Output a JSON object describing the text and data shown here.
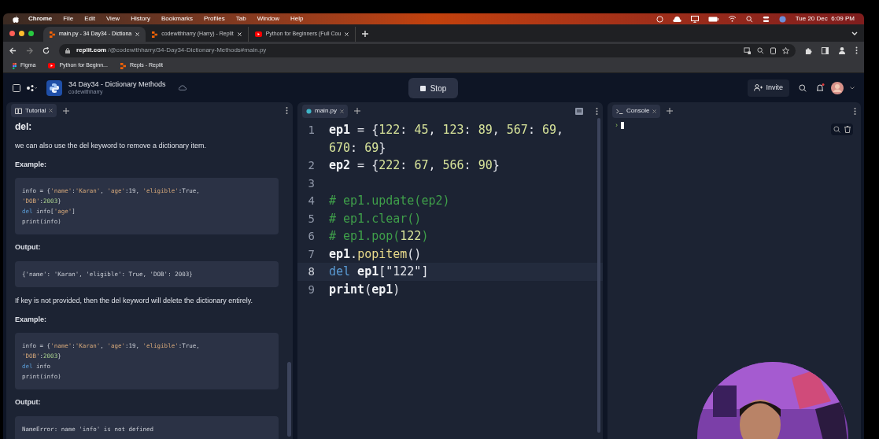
{
  "menu_bar": {
    "items": [
      "Chrome",
      "File",
      "Edit",
      "View",
      "History",
      "Bookmarks",
      "Profiles",
      "Tab",
      "Window",
      "Help"
    ],
    "clock": "Tue 20 Dec  6:09 PM"
  },
  "browser": {
    "tabs": [
      {
        "label": "main.py - 34 Day34 - Dictiona",
        "kind": "replit",
        "selected": true
      },
      {
        "label": "codewithharry (Harry) - Replit",
        "kind": "replit",
        "selected": false
      },
      {
        "label": "Python for Beginners (Full Cou",
        "kind": "youtube",
        "selected": false
      }
    ],
    "address": {
      "host": "replit.com",
      "path": "/@codewithharry/34-Day34-Dictionary-Methods#main.py"
    },
    "bookmarks": [
      {
        "label": "Figma",
        "kind": "figma"
      },
      {
        "label": "Python for Beginn...",
        "kind": "youtube"
      },
      {
        "label": "Repls - Replit",
        "kind": "replit"
      }
    ]
  },
  "repl": {
    "title": "34 Day34 - Dictionary Methods",
    "owner": "codewithharry",
    "run_button": "Stop",
    "invite_button": "Invite"
  },
  "tutorial": {
    "tab": "Tutorial",
    "blocks": [
      {
        "kind": "heading",
        "text": "del:"
      },
      {
        "kind": "para",
        "text": "we can also use the del keyword to remove a dictionary item."
      },
      {
        "kind": "label",
        "text": "Example:"
      },
      {
        "kind": "code",
        "lines": [
          [
            {
              "kind": "plain",
              "text": "info = {"
            },
            {
              "kind": "string",
              "text": "'name'"
            },
            {
              "kind": "plain",
              "text": ":"
            },
            {
              "kind": "string",
              "text": "'Karan'"
            },
            {
              "kind": "plain",
              "text": ", "
            },
            {
              "kind": "string",
              "text": "'age'"
            },
            {
              "kind": "plain",
              "text": ":19, "
            },
            {
              "kind": "string",
              "text": "'eligible'"
            },
            {
              "kind": "plain",
              "text": ":True,"
            }
          ],
          [
            {
              "kind": "string",
              "text": "'DOB'"
            },
            {
              "kind": "plain",
              "text": ":"
            },
            {
              "kind": "number",
              "text": "2003"
            },
            {
              "kind": "plain",
              "text": "}"
            }
          ],
          [
            {
              "kind": "keyword",
              "text": "del"
            },
            {
              "kind": "plain",
              "text": " info["
            },
            {
              "kind": "string",
              "text": "'age'"
            },
            {
              "kind": "plain",
              "text": "]"
            }
          ],
          [
            {
              "kind": "plain",
              "text": "print(info)"
            }
          ]
        ]
      },
      {
        "kind": "label",
        "text": "Output:"
      },
      {
        "kind": "code",
        "lines": [
          [
            {
              "kind": "plain",
              "text": "{'name': 'Karan', 'eligible': True, 'DOB': 2003}"
            }
          ]
        ]
      },
      {
        "kind": "para",
        "text": "If key is not provided, then the del keyword will delete the dictionary entirely."
      },
      {
        "kind": "label",
        "text": "Example:"
      },
      {
        "kind": "code",
        "lines": [
          [
            {
              "kind": "plain",
              "text": "info = {"
            },
            {
              "kind": "string",
              "text": "'name'"
            },
            {
              "kind": "plain",
              "text": ":"
            },
            {
              "kind": "string",
              "text": "'Karan'"
            },
            {
              "kind": "plain",
              "text": ", "
            },
            {
              "kind": "string",
              "text": "'age'"
            },
            {
              "kind": "plain",
              "text": ":19, "
            },
            {
              "kind": "string",
              "text": "'eligible'"
            },
            {
              "kind": "plain",
              "text": ":True,"
            }
          ],
          [
            {
              "kind": "string",
              "text": "'DOB'"
            },
            {
              "kind": "plain",
              "text": ":"
            },
            {
              "kind": "number",
              "text": "2003"
            },
            {
              "kind": "plain",
              "text": "}"
            }
          ],
          [
            {
              "kind": "keyword",
              "text": "del"
            },
            {
              "kind": "plain",
              "text": " info"
            }
          ],
          [
            {
              "kind": "plain",
              "text": "print(info)"
            }
          ]
        ]
      },
      {
        "kind": "label",
        "text": "Output:"
      },
      {
        "kind": "code",
        "lines": [
          [
            {
              "kind": "plain",
              "text": "NameError: name 'info' is not defined"
            }
          ]
        ]
      }
    ]
  },
  "editor": {
    "tab": "main.py",
    "lines": [
      {
        "number": "1",
        "current": false,
        "tokens": [
          {
            "kind": "name",
            "text": "ep1"
          },
          {
            "kind": "punct",
            "text": " = {"
          },
          {
            "kind": "number",
            "text": "122"
          },
          {
            "kind": "punct",
            "text": ": "
          },
          {
            "kind": "number",
            "text": "45"
          },
          {
            "kind": "punct",
            "text": ", "
          },
          {
            "kind": "number",
            "text": "123"
          },
          {
            "kind": "punct",
            "text": ": "
          },
          {
            "kind": "number",
            "text": "89"
          },
          {
            "kind": "punct",
            "text": ", "
          },
          {
            "kind": "number",
            "text": "567"
          },
          {
            "kind": "punct",
            "text": ": "
          },
          {
            "kind": "number",
            "text": "69"
          },
          {
            "kind": "punct",
            "text": ", "
          },
          {
            "kind": "number",
            "text": "670"
          },
          {
            "kind": "punct",
            "text": ": "
          },
          {
            "kind": "number",
            "text": "69"
          },
          {
            "kind": "punct",
            "text": "}"
          }
        ]
      },
      {
        "number": "2",
        "current": false,
        "tokens": [
          {
            "kind": "name",
            "text": "ep2"
          },
          {
            "kind": "punct",
            "text": " = {"
          },
          {
            "kind": "number",
            "text": "222"
          },
          {
            "kind": "punct",
            "text": ": "
          },
          {
            "kind": "number",
            "text": "67"
          },
          {
            "kind": "punct",
            "text": ", "
          },
          {
            "kind": "number",
            "text": "566"
          },
          {
            "kind": "punct",
            "text": ": "
          },
          {
            "kind": "number",
            "text": "90"
          },
          {
            "kind": "punct",
            "text": "}"
          }
        ]
      },
      {
        "number": "3",
        "current": false
      },
      {
        "number": "4",
        "current": false,
        "tokens": [
          {
            "kind": "comment",
            "text": "# ep1.update(ep2)"
          }
        ]
      },
      {
        "number": "5",
        "current": false,
        "tokens": [
          {
            "kind": "comment",
            "text": "# ep1.clear()"
          }
        ]
      },
      {
        "number": "6",
        "current": false,
        "tokens": [
          {
            "kind": "comment",
            "text": "# ep1.pop("
          },
          {
            "kind": "number",
            "text": "122"
          },
          {
            "kind": "comment",
            "text": ")"
          }
        ]
      },
      {
        "number": "7",
        "current": false,
        "tokens": [
          {
            "kind": "name",
            "text": "ep1"
          },
          {
            "kind": "punct",
            "text": "."
          },
          {
            "kind": "func",
            "text": "popitem"
          },
          {
            "kind": "punct",
            "text": "()"
          }
        ]
      },
      {
        "number": "8",
        "current": true,
        "tokens": [
          {
            "kind": "keyword",
            "text": "del"
          },
          {
            "kind": "name",
            "text": " ep1"
          },
          {
            "kind": "punct",
            "text": "["
          },
          {
            "kind": "string",
            "text": "\"122\""
          },
          {
            "kind": "punct",
            "text": "]"
          }
        ]
      },
      {
        "number": "9",
        "current": false,
        "tokens": [
          {
            "kind": "name",
            "text": "print"
          },
          {
            "kind": "punct",
            "text": "("
          },
          {
            "kind": "name",
            "text": "ep1"
          },
          {
            "kind": "punct",
            "text": ")"
          }
        ]
      }
    ]
  },
  "console": {
    "tab": "Console",
    "prompt": "›"
  }
}
